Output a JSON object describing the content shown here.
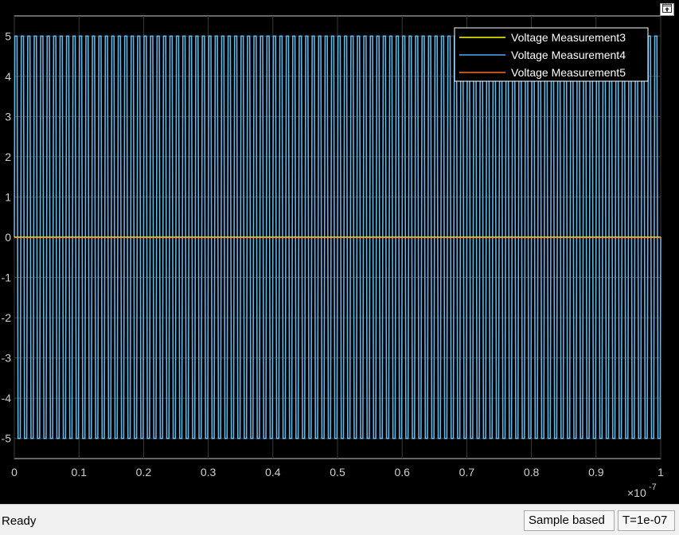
{
  "status_bar": {
    "state": "Ready",
    "sample_mode": "Sample based",
    "time_step": "T=1e-07"
  },
  "colors": {
    "background": "#000000",
    "axes_fill": "#000000",
    "grid": "#3a3a3a",
    "axis_text": "#d0d0d0",
    "series": [
      "#ffff00",
      "#4daaf5",
      "#ff6a2b"
    ]
  },
  "icons": {
    "undock": "undock-icon"
  },
  "chart_data": {
    "type": "line",
    "title": "",
    "xlabel": "",
    "ylabel": "",
    "x_exponent_label": "×10",
    "x_exponent_power": "-7",
    "xlim": [
      0,
      1
    ],
    "ylim": [
      -5.5,
      5.5
    ],
    "x_ticks": [
      "0",
      "0.1",
      "0.2",
      "0.3",
      "0.4",
      "0.5",
      "0.6",
      "0.7",
      "0.8",
      "0.9",
      "1"
    ],
    "y_ticks": [
      "5",
      "4",
      "3",
      "2",
      "1",
      "0",
      "-1",
      "-2",
      "-3",
      "-4",
      "-5"
    ],
    "grid": true,
    "legend_position": "top-right",
    "series": [
      {
        "name": "Voltage Measurement3",
        "description_value": 0,
        "amplitude": 0
      },
      {
        "name": "Voltage Measurement4",
        "amplitude": 5,
        "cycles": 100
      },
      {
        "name": "Voltage Measurement5",
        "amplitude": 0
      }
    ]
  }
}
